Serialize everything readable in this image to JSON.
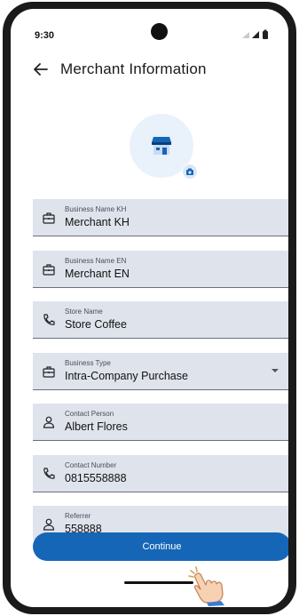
{
  "status_bar": {
    "time": "9:30"
  },
  "header": {
    "title": "Merchant Information"
  },
  "fields": [
    {
      "label": "Business Name KH",
      "value": "Merchant KH",
      "icon": "briefcase-icon"
    },
    {
      "label": "Business Name EN",
      "value": "Merchant EN",
      "icon": "briefcase-icon"
    },
    {
      "label": "Store Name",
      "value": "Store Coffee",
      "icon": "phone-icon"
    },
    {
      "label": "Business Type",
      "value": "Intra-Company Purchase",
      "icon": "briefcase-icon"
    },
    {
      "label": "Contact Person",
      "value": "Albert Flores",
      "icon": "person-icon"
    },
    {
      "label": "Contact Number",
      "value": "0815558888",
      "icon": "phone-icon"
    },
    {
      "label": "Referrer",
      "value": "558888",
      "icon": "person-icon"
    }
  ],
  "continue_label": "Continue",
  "colors": {
    "primary": "#1666b8",
    "field_bg": "#dfe3ec",
    "avatar_bg": "#e9f1fb"
  }
}
